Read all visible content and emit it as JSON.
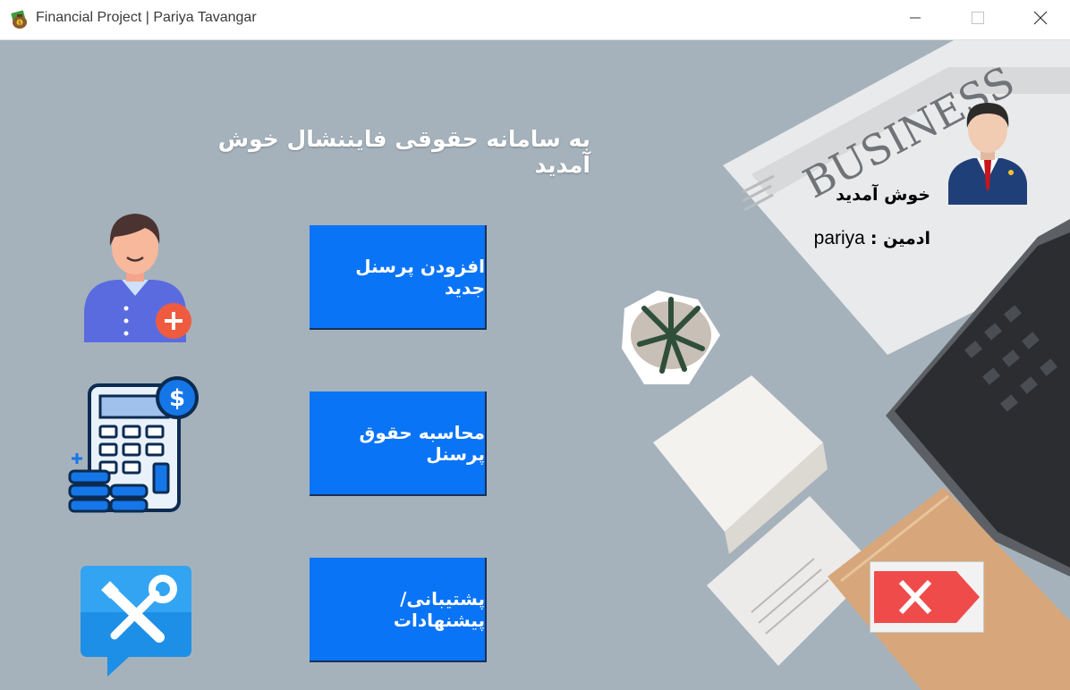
{
  "window": {
    "title": "Financial Project | Pariya Tavangar",
    "icon": "money-bag-icon",
    "controls": [
      "minimize-icon",
      "maximize-icon",
      "close-icon"
    ]
  },
  "main": {
    "welcome_title": "به سامانه حقوقی فایننشال خوش آمدید",
    "buttons": {
      "add_personnel": "افزودن پرسنل جدید",
      "calculate_salary": "محاسبه حقوق پرسنل",
      "support": "پشتیبانی/پیشنهادات"
    },
    "icons": {
      "add_personnel": "add-person-icon",
      "calculate_salary": "calculator-dollar-icon",
      "support": "tools-chat-icon",
      "user": "businessman-avatar-icon",
      "exit": "exit-x-icon"
    }
  },
  "user_panel": {
    "greeting": "خوش آمدید",
    "admin_label": "ادمین :",
    "username": "pariya"
  },
  "background": {
    "photo_text": "BUSINESS"
  },
  "colors": {
    "button_blue": "#0a74f6",
    "background": "#a5b2bc",
    "exit_red": "#f04b4b"
  }
}
